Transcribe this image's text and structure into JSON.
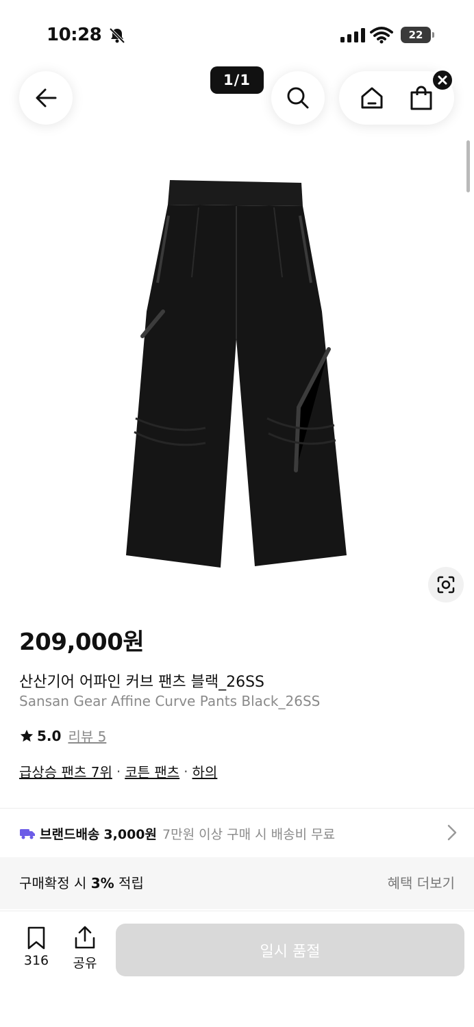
{
  "status_bar": {
    "time": "10:28",
    "battery": "22"
  },
  "header": {
    "page_counter": "1/1"
  },
  "product": {
    "price": "209,000원",
    "name_ko": "산산기어 어파인 커브 팬츠 블랙_26SS",
    "name_en": "Sansan Gear Affine Curve Pants Black_26SS",
    "rating": "5.0",
    "review_label": "리뷰 5",
    "tags": [
      "급상승 팬츠 7위",
      "코튼 팬츠",
      "하의"
    ],
    "tag_separator": "·",
    "image_icon": "black-wide-pants-image"
  },
  "shipping": {
    "brand_label": "브랜드배송",
    "fee": "3,000원",
    "condition": "7만원 이상 구매 시 배송비 무료",
    "icon_color": "#6c5ce7"
  },
  "points": {
    "prefix": "구매확정 시",
    "percent": "3%",
    "suffix": "적립",
    "more_label": "혜택 더보기"
  },
  "bottom_bar": {
    "bookmark_count": "316",
    "share_label": "공유",
    "cta_label": "일시 품절",
    "cta_color": "#d9d9d9"
  }
}
